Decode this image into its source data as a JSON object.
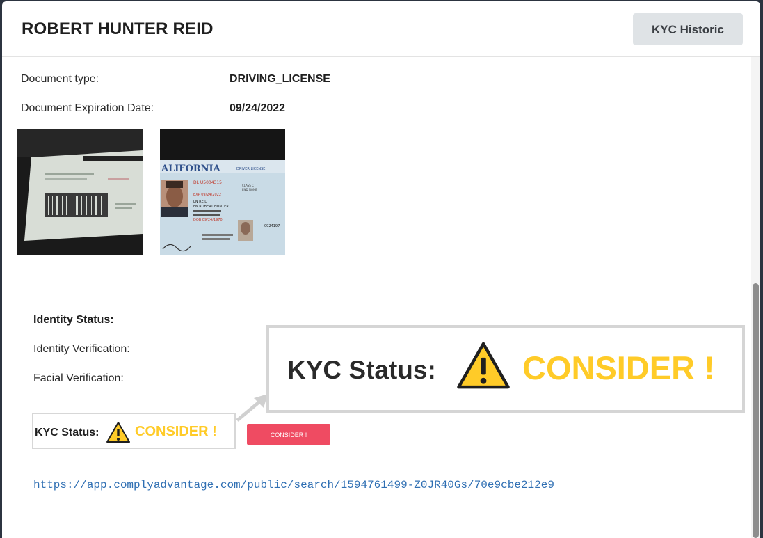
{
  "modal": {
    "title": "ROBERT HUNTER REID",
    "kyc_historic_button": "KYC Historic"
  },
  "document": {
    "type_label": "Document type:",
    "type_value": "DRIVING_LICENSE",
    "expiration_label": "Document Expiration Date:",
    "expiration_value": "09/24/2022",
    "license_front_text": {
      "state": "ALIFORNIA",
      "header": "DRIVER LICENSE",
      "number": "DL U5004315",
      "expiry": "EXP 09/24/2022",
      "surname": "LN REID",
      "given_name": "FN ROBERT HUNTER",
      "dob": "DOB 09/24/1970",
      "class": "CLASS C",
      "end": "END NONE",
      "side_number": "0924197"
    }
  },
  "status": {
    "identity_status_label": "Identity Status:",
    "identity_verification_label": "Identity Verification:",
    "facial_verification_label": "Facial Verification:",
    "kyc_status_label": "KYC Status:",
    "kyc_status_value": "CONSIDER !",
    "consider_button": "CONSIDER !"
  },
  "zoom_callout": {
    "kyc_status_label": "KYC Status:",
    "kyc_status_value": "CONSIDER !"
  },
  "link": {
    "url": "https://app.complyadvantage.com/public/search/1594761499-Z0JR40Gs/70e9cbe212e9"
  },
  "icons": [
    "warning-icon",
    "arrow-pointer-icon"
  ],
  "colors": {
    "consider_yellow": "#ffcb28",
    "consider_button_bg": "#ef4b62",
    "link_blue": "#2f6fb3"
  }
}
